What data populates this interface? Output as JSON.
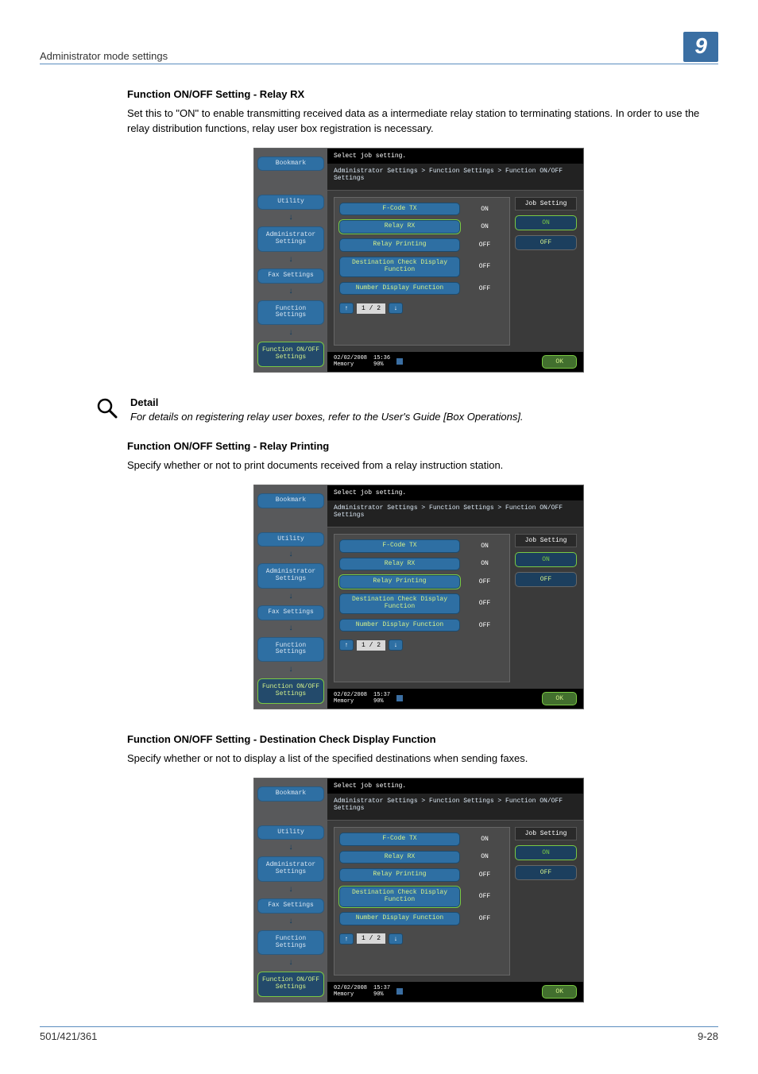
{
  "header": {
    "breadcrumb": "Administrator mode settings",
    "chapter": "9"
  },
  "sections": [
    {
      "heading": "Function ON/OFF Setting - Relay RX",
      "paragraph": "Set this to \"ON\" to enable transmitting received data as a intermediate relay station to terminating stations. In order to use the relay distribution functions, relay user box registration is necessary."
    },
    {
      "heading": "Function ON/OFF Setting - Relay Printing",
      "paragraph": "Specify whether or not to print documents received from a relay instruction station."
    },
    {
      "heading": "Function ON/OFF Setting - Destination Check Display Function",
      "paragraph": "Specify whether or not to display a list of the specified destinations when sending faxes."
    }
  ],
  "detail": {
    "label": "Detail",
    "text": "For details on registering relay user boxes, refer to the User's Guide [Box Operations]."
  },
  "panel_common": {
    "sidebar": {
      "bookmark": "Bookmark",
      "utility": "Utility",
      "admin": "Administrator\nSettings",
      "fax": "Fax Settings",
      "func": "Function\nSettings",
      "onoff": "Function ON/OFF\nSettings"
    },
    "topbar": "Select job setting.",
    "crumb": "Administrator Settings > Function Settings > Function ON/OFF Settings",
    "rows": [
      {
        "label": "F-Code TX",
        "value": "ON"
      },
      {
        "label": "Relay RX",
        "value": "ON"
      },
      {
        "label": "Relay Printing",
        "value": "OFF"
      },
      {
        "label": "Destination Check\nDisplay Function",
        "value": "OFF"
      },
      {
        "label": "Number Display Function",
        "value": "OFF"
      }
    ],
    "pager": "1 / 2",
    "right": {
      "header": "Job Setting",
      "on": "ON",
      "off": "OFF"
    },
    "footer": {
      "date": "02/02/2008",
      "memory_label": "Memory",
      "memory": "90%",
      "ok": "OK"
    }
  },
  "panel_times": [
    "15:36",
    "15:37",
    "15:37"
  ],
  "panel_selected": [
    1,
    2,
    3
  ],
  "footer": {
    "left": "501/421/361",
    "right": "9-28"
  }
}
